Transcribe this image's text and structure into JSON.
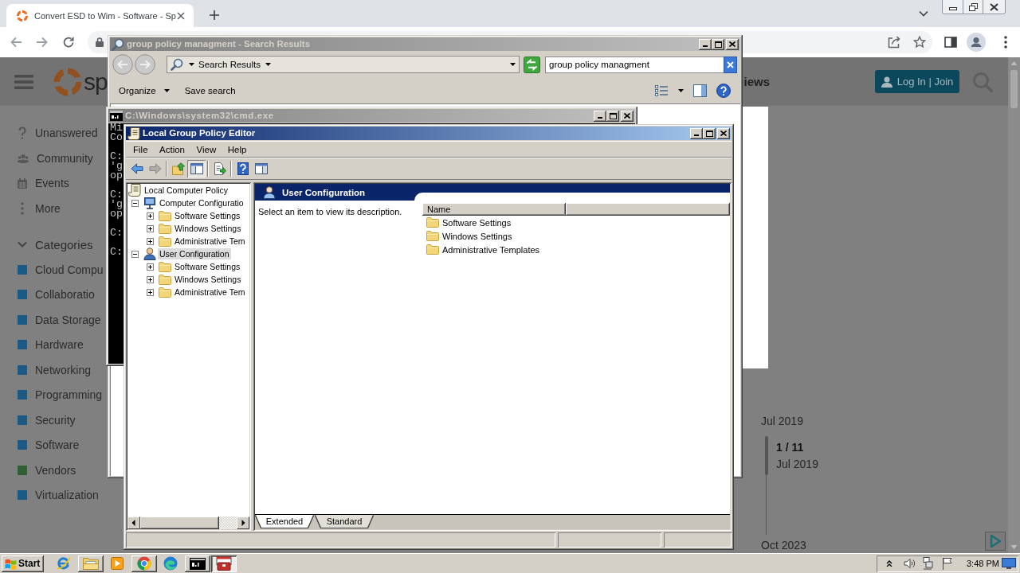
{
  "browser": {
    "tabs": [
      {
        "title": "Convert ESD to Wim - Software - Sp",
        "selected": true
      }
    ],
    "page": {
      "logo_text": "sp",
      "nav_link": "iews",
      "login_button": "Log In | Join",
      "links": [
        {
          "label": "Unanswered",
          "kind": "question"
        },
        {
          "label": "Community",
          "kind": "people"
        },
        {
          "label": "Events",
          "kind": "calendar"
        },
        {
          "label": "More",
          "kind": "more"
        }
      ],
      "categories": {
        "heading": "Categories",
        "expanded": true,
        "items": [
          {
            "label": "Cloud Compu",
            "color": "#1b5a87"
          },
          {
            "label": "Collaboratio",
            "color": "#1b5a87"
          },
          {
            "label": "Data Storage",
            "color": "#1b5a87"
          },
          {
            "label": "Hardware",
            "color": "#1b5a87"
          },
          {
            "label": "Networking",
            "color": "#1b5a87"
          },
          {
            "label": "Programming",
            "color": "#1b5a87"
          },
          {
            "label": "Security",
            "color": "#1b5a87"
          },
          {
            "label": "Software",
            "color": "#1b5a87"
          },
          {
            "label": "Vendors",
            "color": "#2f5f35"
          },
          {
            "label": "Virtualization",
            "color": "#1b5a87"
          }
        ]
      },
      "timeline": {
        "start": "Jul 2019",
        "position": "1 / 11",
        "position_date": "Jul 2019",
        "end": "Oct 2023"
      }
    }
  },
  "search_window": {
    "title": "group policy managment - Search Results",
    "active": false,
    "location": "Search Results",
    "search_value": "group policy managment",
    "commands": [
      {
        "label": "Organize",
        "menu": true
      },
      {
        "label": "Save search",
        "menu": false
      }
    ]
  },
  "console_window": {
    "title": "C:\\Windows\\system32\\cmd.exe",
    "active": false,
    "blocks": [
      [
        "Mi",
        "Co"
      ],
      [
        "C:",
        "'g",
        "op"
      ],
      [
        "C:",
        "'g",
        "op"
      ],
      [
        "C:"
      ],
      [
        "C:"
      ]
    ]
  },
  "policy_editor": {
    "title": "Local Group Policy Editor",
    "active": true,
    "menu": [
      "File",
      "Action",
      "View",
      "Help"
    ],
    "toolbar": [
      [
        {
          "kind": "back",
          "disabled": false,
          "pressed": false
        },
        {
          "kind": "forward",
          "disabled": true,
          "pressed": false
        }
      ],
      [
        {
          "kind": "up",
          "disabled": false,
          "pressed": false
        },
        {
          "kind": "tree",
          "disabled": false,
          "pressed": true
        }
      ],
      [
        {
          "kind": "export",
          "disabled": false,
          "pressed": false
        }
      ],
      [
        {
          "kind": "help",
          "disabled": false,
          "pressed": false
        },
        {
          "kind": "pane",
          "disabled": false,
          "pressed": false
        }
      ]
    ],
    "tree": [
      {
        "label": "Local Computer Policy",
        "kind": "policy",
        "selected": false,
        "children": [
          {
            "label": "Computer Configuratio",
            "kind": "computer",
            "expanded": true,
            "selected": false,
            "children": [
              {
                "label": "Software Settings",
                "kind": "folder",
                "expanded": false,
                "selected": false
              },
              {
                "label": "Windows Settings",
                "kind": "folder",
                "expanded": false,
                "selected": false
              },
              {
                "label": "Administrative Tem",
                "kind": "folder",
                "expanded": false,
                "selected": false
              }
            ]
          },
          {
            "label": "User Configuration",
            "kind": "user",
            "expanded": true,
            "selected": true,
            "children": [
              {
                "label": "Software Settings",
                "kind": "folder",
                "expanded": false,
                "selected": false
              },
              {
                "label": "Windows Settings",
                "kind": "folder",
                "expanded": false,
                "selected": false
              },
              {
                "label": "Administrative Tem",
                "kind": "folder",
                "expanded": false,
                "selected": false
              }
            ]
          }
        ]
      }
    ],
    "details": {
      "heading": "User Configuration",
      "description": "Select an item to view its description.",
      "columns": [
        "Name"
      ],
      "items": [
        "Software Settings",
        "Windows Settings",
        "Administrative Templates"
      ]
    },
    "view_tabs": [
      {
        "label": "Extended",
        "selected": true
      },
      {
        "label": "Standard",
        "selected": false
      }
    ]
  },
  "taskbar": {
    "start": "Start",
    "apps": [
      {
        "kind": "globe",
        "open": false,
        "active": false
      },
      {
        "kind": "folder",
        "open": true,
        "active": false
      },
      {
        "kind": "media",
        "open": false,
        "active": false
      },
      {
        "kind": "wheel",
        "open": true,
        "active": false
      },
      {
        "kind": "wave",
        "open": false,
        "active": false
      },
      {
        "kind": "console",
        "open": true,
        "active": false
      },
      {
        "kind": "toolbox",
        "open": true,
        "active": true
      }
    ],
    "clock": "3:48 PM"
  }
}
